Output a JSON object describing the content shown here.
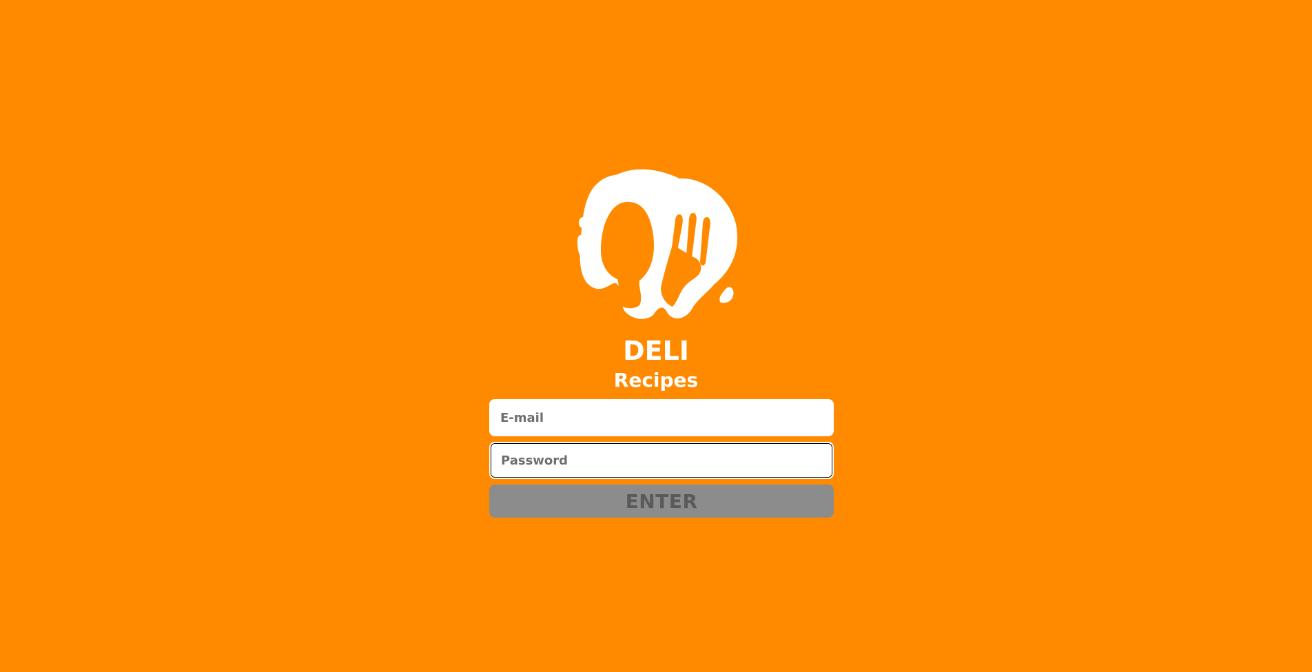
{
  "app": {
    "title": "DELI",
    "subtitle": "Recipes",
    "logo_icon": "spoon-fork-icon"
  },
  "login_form": {
    "email_placeholder": "E-mail",
    "email_value": "",
    "password_placeholder": "Password",
    "password_value": "",
    "submit_label": "ENTER"
  },
  "colors": {
    "background": "#FF8A00",
    "text": "#FFFFFF",
    "input_background": "#FFFFFF",
    "button_disabled": "#8C8C8C",
    "button_text": "#5A5A5A"
  }
}
